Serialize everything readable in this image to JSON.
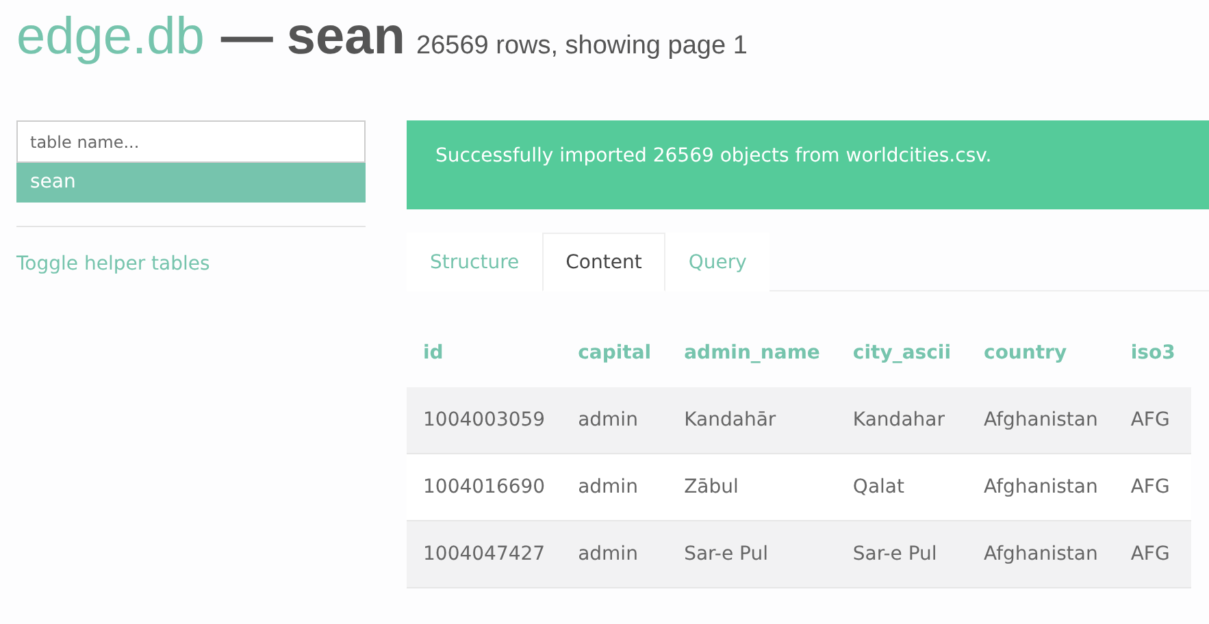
{
  "header": {
    "app": "edge.db",
    "separator": "—",
    "table": "sean",
    "summary": "26569 rows, showing page 1"
  },
  "sidebar": {
    "search": {
      "placeholder": "table name..."
    },
    "tables": [
      {
        "label": "sean",
        "selected": true
      }
    ],
    "link": "Toggle helper tables"
  },
  "alert": "Successfully imported 26569 objects from worldcities.csv.",
  "tabs": [
    {
      "label": "Structure",
      "selected": false
    },
    {
      "label": "Content",
      "selected": true
    },
    {
      "label": "Query",
      "selected": false
    }
  ],
  "table": {
    "columns": [
      "id",
      "capital",
      "admin_name",
      "city_ascii",
      "country",
      "iso3"
    ],
    "rows": [
      [
        "1004003059",
        "admin",
        "Kandahār",
        "Kandahar",
        "Afghanistan",
        "AFG"
      ],
      [
        "1004016690",
        "admin",
        "Zābul",
        "Qalat",
        "Afghanistan",
        "AFG"
      ],
      [
        "1004047427",
        "admin",
        "Sar-e Pul",
        "Sar-e Pul",
        "Afghanistan",
        "AFG"
      ]
    ]
  }
}
